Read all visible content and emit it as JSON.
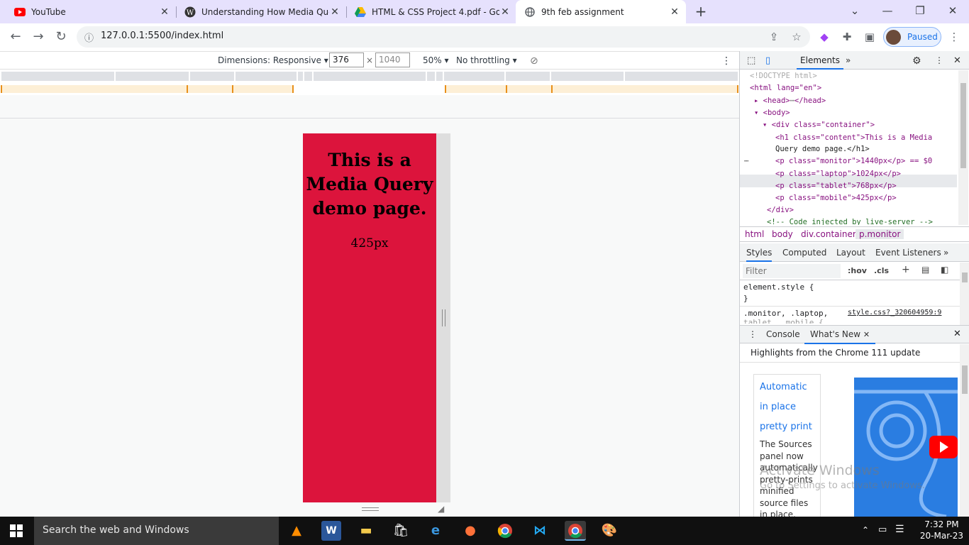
{
  "tabs": [
    {
      "title": "YouTube",
      "icon": "youtube-icon"
    },
    {
      "title": "Understanding How Media Quer",
      "icon": "wordpress-icon"
    },
    {
      "title": "HTML & CSS Project 4.pdf - Goo",
      "icon": "google-drive-icon"
    },
    {
      "title": "9th feb assignment",
      "icon": "globe-icon"
    }
  ],
  "address": {
    "url": "127.0.0.1:5500/index.html"
  },
  "profile": {
    "label": "Paused"
  },
  "device_toolbar": {
    "dimensions_label": "Dimensions: Responsive",
    "width": "376",
    "height": "1040",
    "times": "×",
    "zoom": "50%",
    "throttling": "No throttling"
  },
  "page": {
    "heading": "This is a Media Query demo page.",
    "visible_p": "425px",
    "bg_color": "#dc143c"
  },
  "devtools": {
    "tab_elements": "Elements",
    "dom": {
      "doctype": "<!DOCTYPE html>",
      "html_open": "<html lang=\"en\">",
      "head": "<head>",
      "head_close": "</head>",
      "body": "<body>",
      "div": "<div class=\"container\">",
      "h1_line1": "<h1 class=\"content\">This is a Media",
      "h1_line2": "Query demo page.</h1>",
      "p1": "<p class=\"monitor\">1440px</p> == $0",
      "p2": "<p class=\"laptop\">1024px</p>",
      "p3": "<p class=\"tablet\">768px</p>",
      "p4": "<p class=\"mobile\">425px</p>",
      "div_close": "</div>",
      "comment": "<!-- Code injected by live-server -->"
    },
    "breadcrumbs": [
      "html",
      "body",
      "div.container",
      "p.monitor"
    ],
    "style_tabs": [
      "Styles",
      "Computed",
      "Layout",
      "Event Listeners"
    ],
    "filter_placeholder": "Filter",
    "hov": ":hov",
    "cls": ".cls",
    "rule1": "element.style {",
    "rule1_close": "}",
    "rule2_selector": ".monitor, .laptop,",
    "rule2_selector2": "tablet, .mobile {",
    "rule2_source": "style.css?_320604959:9",
    "drawer_tabs": [
      "Console",
      "What's New"
    ],
    "whats_new_heading": "Highlights from the Chrome 111 update",
    "card_link": [
      "Automatic",
      "in place",
      "pretty print"
    ],
    "card_desc": "The Sources panel now automatically pretty-prints minified source files in place."
  },
  "watermark": {
    "title": "Activate Windows",
    "sub": "Go to Settings to activate Windows."
  },
  "taskbar": {
    "search": "Search the web and Windows",
    "time": "7:32 PM",
    "date": "20-Mar-23"
  }
}
